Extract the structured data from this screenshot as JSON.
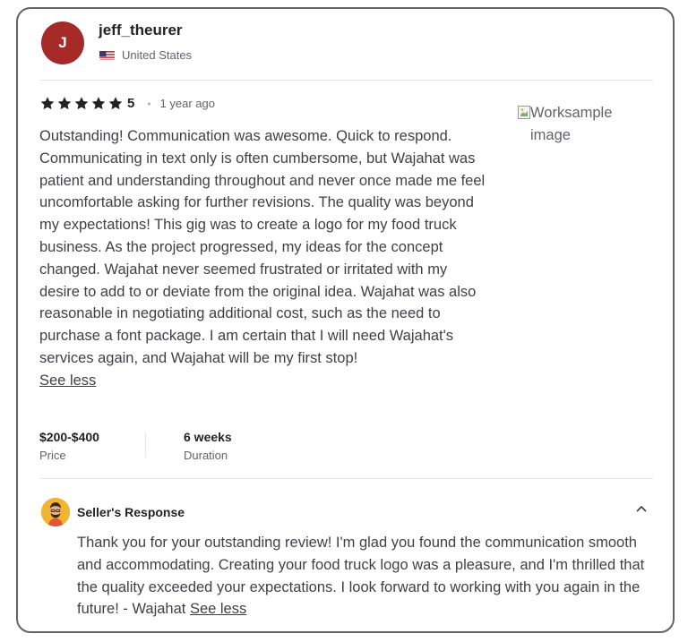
{
  "reviewer": {
    "initial": "J",
    "username": "jeff_theurer",
    "country": "United States"
  },
  "review": {
    "rating": 5,
    "rating_label": "5",
    "time_ago": "1 year ago",
    "text": "Outstanding! Communication was awesome. Quick to respond. Communicating in text only is often cumbersome, but Wajahat was patient and understanding throughout and never once made me feel uncomfortable asking for further revisions. The quality was beyond my expectations! This gig was to create a logo for my food truck business. As the project progressed, my ideas for the concept changed. Wajahat never seemed frustrated or irritated with my desire to add to or deviate from the original idea. Wajahat was also reasonable in negotiating additional cost, such as the need to purchase a font package. I am certain that I will need Wajahat's services again, and Wajahat will be my first stop!",
    "see_less": "See less",
    "worksample_alt": "Worksample image"
  },
  "stats": {
    "price_value": "$200-$400",
    "price_label": "Price",
    "duration_value": "6 weeks",
    "duration_label": "Duration"
  },
  "seller_response": {
    "title": "Seller's Response",
    "text": "Thank you for your outstanding review! I'm glad you found the communication smooth and accommodating. Creating your food truck logo was a pleasure, and I'm thrilled that the quality exceeded your expectations. I look forward to working with you again in the future! - Wajahat",
    "see_less": "See less"
  },
  "colors": {
    "avatar_bg": "#a62a28",
    "star": "#222325",
    "text": "#404145",
    "muted": "#62646a",
    "border": "#62646a"
  },
  "icons": {
    "flag": "us-flag-icon",
    "star": "star-icon",
    "collapse": "chevron-up-icon",
    "broken_image": "broken-image-icon"
  }
}
